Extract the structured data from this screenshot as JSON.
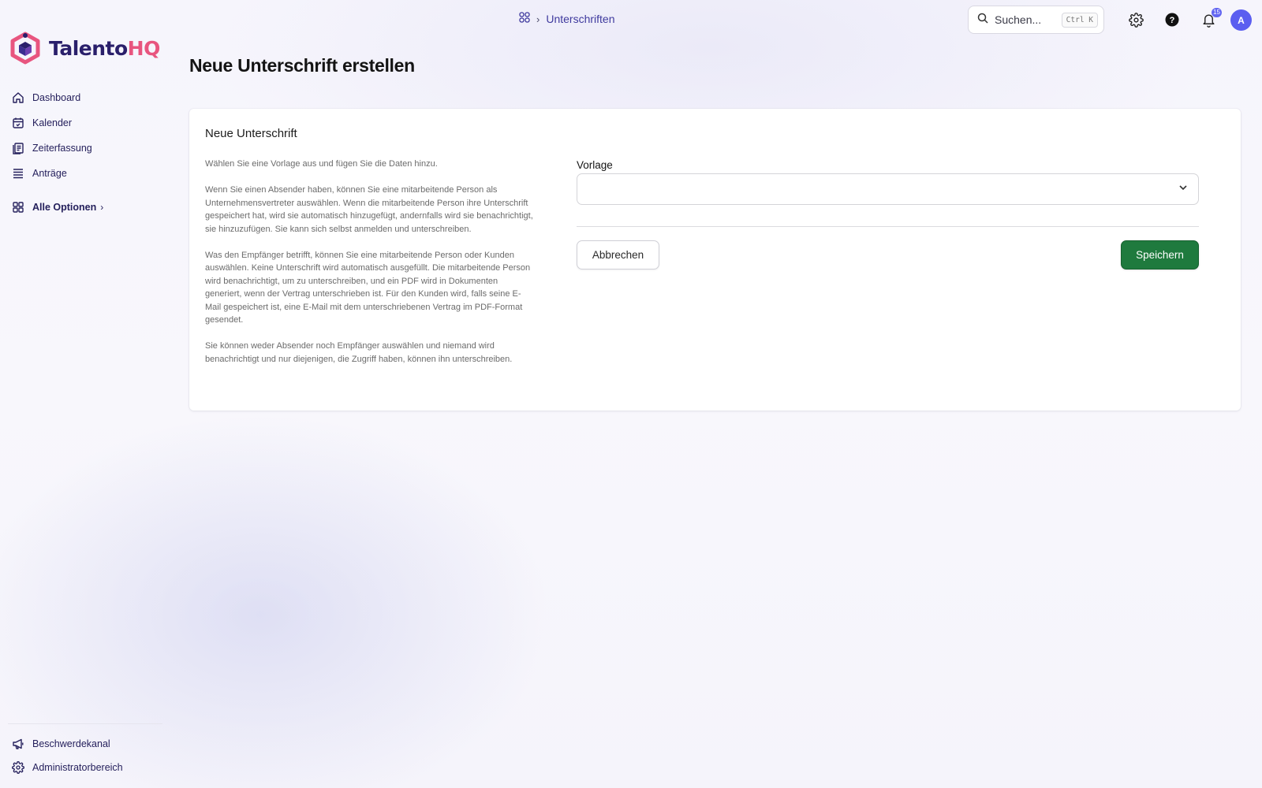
{
  "app": {
    "name_part1": "Talento",
    "name_part2": "HQ"
  },
  "colors": {
    "brand_dark": "#2a1f6b",
    "brand_pink": "#e8557f",
    "accent": "#5b5ef0",
    "save_green": "#1f7a3e"
  },
  "sidebar": {
    "items": [
      {
        "label": "Dashboard",
        "icon": "home-icon"
      },
      {
        "label": "Kalender",
        "icon": "calendar-icon"
      },
      {
        "label": "Zeiterfassung",
        "icon": "timesheet-icon"
      },
      {
        "label": "Anträge",
        "icon": "list-icon"
      }
    ],
    "all_options": "Alle Optionen",
    "bottom": [
      {
        "label": "Beschwerdekanal",
        "icon": "megaphone-icon"
      },
      {
        "label": "Administratorbereich",
        "icon": "gear-icon"
      }
    ]
  },
  "header": {
    "breadcrumb": "Unterschriften",
    "search_placeholder": "Suchen...",
    "search_shortcut": "Ctrl K",
    "notification_count": "15",
    "avatar_initial": "A"
  },
  "page": {
    "title": "Neue Unterschrift erstellen"
  },
  "card": {
    "title": "Neue Unterschrift",
    "paragraphs": [
      "Wählen Sie eine Vorlage aus und fügen Sie die Daten hinzu.",
      "Wenn Sie einen Absender haben, können Sie eine mitarbeitende Person als Unternehmensvertreter auswählen. Wenn die mitarbeitende Person ihre Unterschrift gespeichert hat, wird sie automatisch hinzugefügt, andernfalls wird sie benachrichtigt, sie hinzuzufügen. Sie kann sich selbst anmelden und unterschreiben.",
      "Was den Empfänger betrifft, können Sie eine mitarbeitende Person oder Kunden auswählen. Keine Unterschrift wird automatisch ausgefüllt. Die mitarbeitende Person wird benachrichtigt, um zu unterschreiben, und ein PDF wird in Dokumenten generiert, wenn der Vertrag unterschrieben ist. Für den Kunden wird, falls seine E-Mail gespeichert ist, eine E-Mail mit dem unterschriebenen Vertrag im PDF-Format gesendet.",
      "Sie können weder Absender noch Empfänger auswählen und niemand wird benachrichtigt und nur diejenigen, die Zugriff haben, können ihn unterschreiben."
    ],
    "form": {
      "template_label": "Vorlage",
      "template_value": "",
      "cancel_label": "Abbrechen",
      "save_label": "Speichern"
    }
  }
}
